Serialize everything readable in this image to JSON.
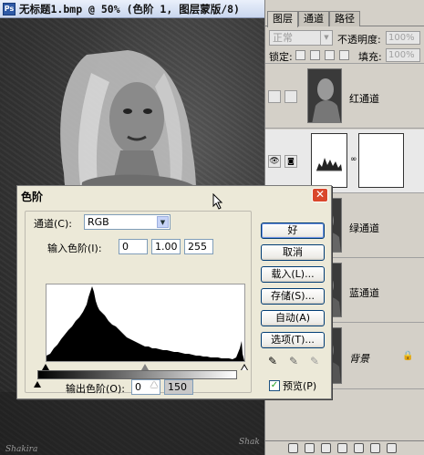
{
  "document": {
    "title": "无标题1.bmp @ 50% (色阶 1, 图层蒙版/8)",
    "watermark_left": "Shakira",
    "watermark_right": "Shak"
  },
  "panel": {
    "tabs": [
      "图层",
      "通道",
      "路径"
    ],
    "blend_mode": "正常",
    "opacity_label": "不透明度:",
    "opacity_value": "100%",
    "lock_label": "锁定:",
    "fill_label": "填充:",
    "fill_value": "100%",
    "rows": [
      {
        "label": "红通道"
      },
      {
        "label": ""
      },
      {
        "label": "绿通道"
      },
      {
        "label": "蓝通道"
      },
      {
        "label": "背景"
      }
    ]
  },
  "levels": {
    "title": "色阶",
    "channel_label": "通道(C):",
    "channel_value": "RGB",
    "input_label": "输入色阶(I):",
    "input_values": [
      "0",
      "1.00",
      "255"
    ],
    "output_label": "输出色阶(O):",
    "output_values": [
      "0",
      "150"
    ],
    "buttons": {
      "ok": "好",
      "cancel": "取消",
      "load": "载入(L)...",
      "save": "存储(S)...",
      "auto": "自动(A)",
      "options": "选项(T)..."
    },
    "preview_label": "预览(P)",
    "preview_checked": true
  },
  "colors": {
    "title_gradient_top": "#eaf0fb",
    "close_button": "#d9472b",
    "dialog_bg": "#ece9d8"
  }
}
